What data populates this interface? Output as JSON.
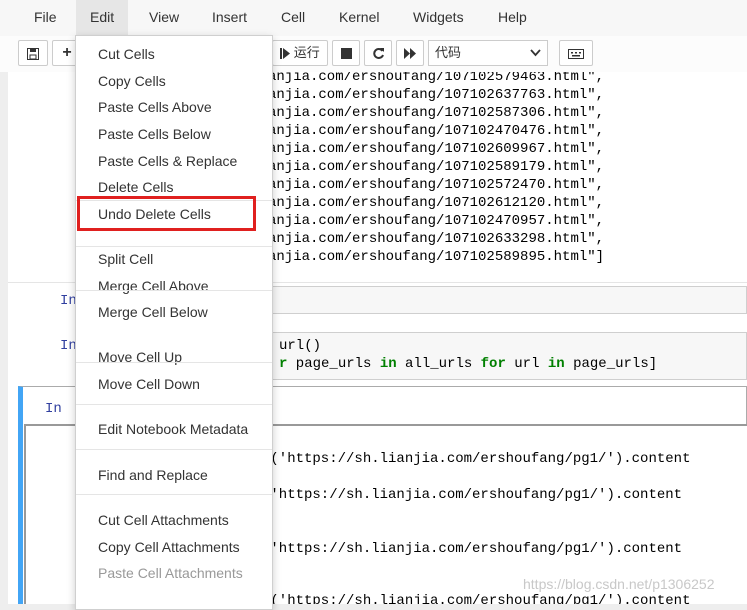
{
  "menubar": {
    "items": [
      "File",
      "Edit",
      "View",
      "Insert",
      "Cell",
      "Kernel",
      "Widgets",
      "Help"
    ],
    "active": "Edit"
  },
  "toolbar": {
    "run_label": "运行",
    "celltype_value": "代码",
    "icons": [
      "save-icon",
      "plus-icon",
      "run-icon",
      "stop-icon",
      "restart-icon",
      "fast-forward-icon",
      "keyboard-icon"
    ]
  },
  "edit_menu": {
    "items": [
      {
        "label": "Cut Cells",
        "enabled": true
      },
      {
        "label": "Copy Cells",
        "enabled": true
      },
      {
        "label": "Paste Cells Above",
        "enabled": true
      },
      {
        "label": "Paste Cells Below",
        "enabled": true
      },
      {
        "label": "Paste Cells & Replace",
        "enabled": true
      },
      {
        "label": "Delete Cells",
        "enabled": true
      },
      {
        "label": "Undo Delete Cells",
        "enabled": true,
        "highlighted": true
      },
      {
        "label": "Split Cell",
        "enabled": true
      },
      {
        "label": "Merge Cell Above",
        "enabled": true
      },
      {
        "label": "Merge Cell Below",
        "enabled": true
      },
      {
        "label": "Move Cell Up",
        "enabled": true
      },
      {
        "label": "Move Cell Down",
        "enabled": true
      },
      {
        "label": "Edit Notebook Metadata",
        "enabled": true
      },
      {
        "label": "Find and Replace",
        "enabled": true
      },
      {
        "label": "Cut Cell Attachments",
        "enabled": true
      },
      {
        "label": "Copy Cell Attachments",
        "enabled": true
      },
      {
        "label": "Paste Cell Attachments",
        "enabled": false
      }
    ],
    "highlight_color": "#e0201f"
  },
  "notebook": {
    "output_lines": [
      "anjia.com/ershoufang/107102579463.html\",",
      "anjia.com/ershoufang/107102637763.html\",",
      "anjia.com/ershoufang/107102587306.html\",",
      "anjia.com/ershoufang/107102470476.html\",",
      "anjia.com/ershoufang/107102609967.html\",",
      "anjia.com/ershoufang/107102589179.html\",",
      "anjia.com/ershoufang/107102572470.html\",",
      "anjia.com/ershoufang/107102612120.html\",",
      "anjia.com/ershoufang/107102470957.html\",",
      "anjia.com/ershoufang/107102633298.html\",",
      "anjia.com/ershoufang/107102589895.html\"]"
    ],
    "prompt_in_1": "In",
    "prompt_in_2": "In",
    "prompt_in_3": "In",
    "code_line_1": "url()",
    "code_line_2_kw1": "r",
    "code_line_2_mid1": " page_urls ",
    "code_line_2_kw2": "in",
    "code_line_2_mid2": " all_urls ",
    "code_line_2_kw3": "for",
    "code_line_2_mid3": " url ",
    "code_line_2_kw4": "in",
    "code_line_2_end": " page_urls]",
    "output_2_lines": [
      "t('https://sh.lianjia.com/ershoufang/pg1/').content",
      "('https://sh.lianjia.com/ershoufang/pg1/').content",
      "('https://sh.lianjia.com/ershoufang/pg1/').content",
      "t('https://sh.lianjia.com/ershoufang/pg1/').content"
    ]
  },
  "watermark": "https://blog.csdn.net/p1306252"
}
